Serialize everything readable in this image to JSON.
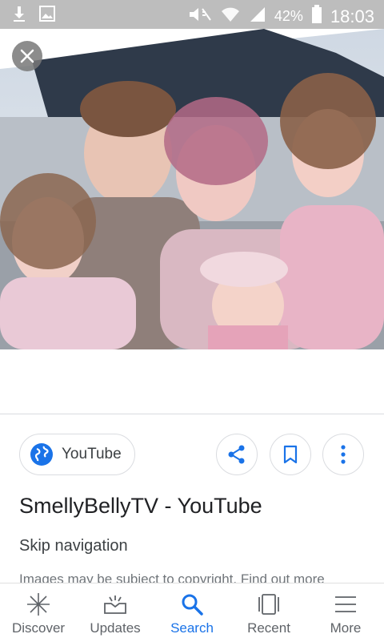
{
  "status_bar": {
    "battery": "42%",
    "time": "18:03"
  },
  "image_viewer": {
    "close_icon": "close-icon"
  },
  "result": {
    "source": "YouTube",
    "title": "SmellyBellyTV - YouTube",
    "subtitle": "Skip navigation",
    "copyright": "Images may be subject to copyright. Find out more"
  },
  "actions": {
    "share": "share-icon",
    "save": "bookmark-icon",
    "more": "more-vert-icon"
  },
  "bottom_nav": [
    {
      "label": "Discover",
      "icon": "asterisk-icon"
    },
    {
      "label": "Updates",
      "icon": "updates-icon"
    },
    {
      "label": "Search",
      "icon": "search-icon",
      "active": true
    },
    {
      "label": "Recent",
      "icon": "recent-icon"
    },
    {
      "label": "More",
      "icon": "menu-icon"
    }
  ],
  "colors": {
    "accent": "#1a73e8",
    "divider": "#dadce0",
    "status_bar": "#bdbdbd"
  }
}
